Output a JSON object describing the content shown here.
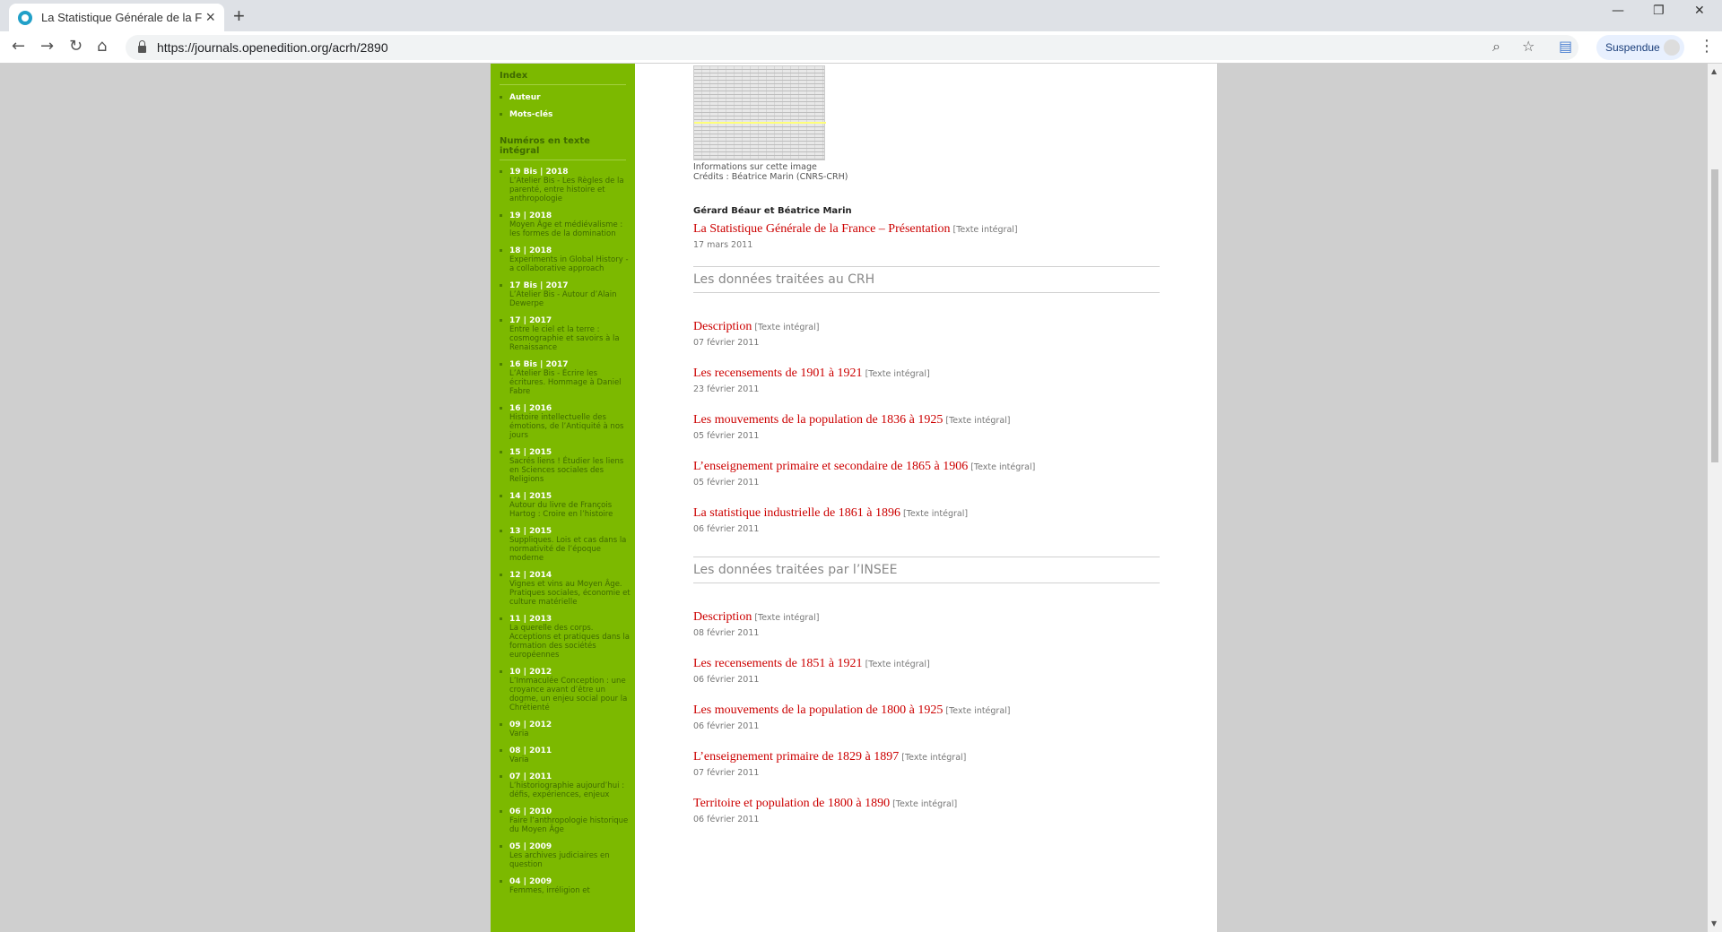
{
  "browser": {
    "tab_title": "La Statistique Générale de la Fran",
    "tab_close": "×",
    "new_tab": "+",
    "url": "https://journals.openedition.org/acrh/2890",
    "profile_label": "Suspendue",
    "minimize": "—",
    "restore": "❐",
    "close": "✕"
  },
  "sidebar": {
    "index_heading": "Index",
    "index_items": [
      "Auteur",
      "Mots-clés"
    ],
    "issues_heading": "Numéros en texte intégral",
    "issues": [
      {
        "num": "19 Bis | 2018",
        "desc": "L’Atelier Bis - Les Règles de la parenté, entre histoire et anthropologie"
      },
      {
        "num": "19 | 2018",
        "desc": "Moyen Âge et médiévalisme : les formes de la domination"
      },
      {
        "num": "18 | 2018",
        "desc": "Experiments in Global History - a collaborative approach"
      },
      {
        "num": "17 Bis | 2017",
        "desc": "L’Atelier Bis - Autour d’Alain Dewerpe"
      },
      {
        "num": "17 | 2017",
        "desc": "Entre le ciel et la terre : cosmographie et savoirs à la Renaissance"
      },
      {
        "num": "16 Bis | 2017",
        "desc": "L’Atelier Bis - Écrire les écritures. Hommage à Daniel Fabre"
      },
      {
        "num": "16 | 2016",
        "desc": "Histoire intellectuelle des émotions, de l’Antiquité à nos jours"
      },
      {
        "num": "15 | 2015",
        "desc": "Sacrés liens ! Étudier les liens en Sciences sociales des Religions"
      },
      {
        "num": "14 | 2015",
        "desc": "Autour du livre de François Hartog : Croire en l’histoire"
      },
      {
        "num": "13 | 2015",
        "desc": "Suppliques. Lois et cas dans la normativité de l’époque moderne"
      },
      {
        "num": "12 | 2014",
        "desc": "Vignes et vins au Moyen Âge. Pratiques sociales, économie et culture matérielle"
      },
      {
        "num": "11 | 2013",
        "desc": "La querelle des corps. Acceptions et pratiques dans la formation des sociétés européennes"
      },
      {
        "num": "10 | 2012",
        "desc": "L’Immaculée Conception : une croyance avant d’être un dogme, un enjeu social pour la Chrétienté"
      },
      {
        "num": "09 | 2012",
        "desc": "Varia"
      },
      {
        "num": "08 | 2011",
        "desc": "Varia"
      },
      {
        "num": "07 | 2011",
        "desc": "L’historiographie aujourd’hui : défis, expériences, enjeux"
      },
      {
        "num": "06 | 2010",
        "desc": "Faire l’anthropologie historique du Moyen Âge"
      },
      {
        "num": "05 | 2009",
        "desc": "Les archives judiciaires en question"
      },
      {
        "num": "04 | 2009",
        "desc": "Femmes, irréligion et"
      }
    ]
  },
  "main": {
    "image_info": "Informations sur cette image",
    "image_credits": "Crédits : Béatrice Marin (CNRS-CRH)",
    "authors": "Gérard Béaur et Béatrice Marin",
    "intro": {
      "title": "La Statistique Générale de la France – Présentation",
      "tag": "[Texte intégral]",
      "date": "17 mars 2011"
    },
    "section1_title": "Les données traitées au CRH",
    "section1": [
      {
        "title": "Description",
        "tag": "[Texte intégral]",
        "date": "07 février 2011"
      },
      {
        "title": "Les recensements de 1901 à 1921",
        "tag": "[Texte intégral]",
        "date": "23 février 2011"
      },
      {
        "title": "Les mouvements de la population de 1836 à 1925",
        "tag": "[Texte intégral]",
        "date": "05 février 2011"
      },
      {
        "title": "L’enseignement primaire et secondaire de 1865 à 1906",
        "tag": "[Texte intégral]",
        "date": "05 février 2011"
      },
      {
        "title": "La statistique industrielle de 1861 à 1896",
        "tag": "[Texte intégral]",
        "date": "06 février 2011"
      }
    ],
    "section2_title": "Les données traitées par l’INSEE",
    "section2": [
      {
        "title": "Description",
        "tag": "[Texte intégral]",
        "date": "08 février 2011"
      },
      {
        "title": "Les recensements de 1851 à 1921",
        "tag": "[Texte intégral]",
        "date": "06 février 2011"
      },
      {
        "title": "Les mouvements de la population de 1800 à 1925",
        "tag": "[Texte intégral]",
        "date": "06 février 2011"
      },
      {
        "title": "L’enseignement primaire de 1829 à 1897",
        "tag": "[Texte intégral]",
        "date": "07 février 2011"
      },
      {
        "title": "Territoire et population de 1800 à 1890",
        "tag": "[Texte intégral]",
        "date": "06 février 2011"
      }
    ]
  }
}
